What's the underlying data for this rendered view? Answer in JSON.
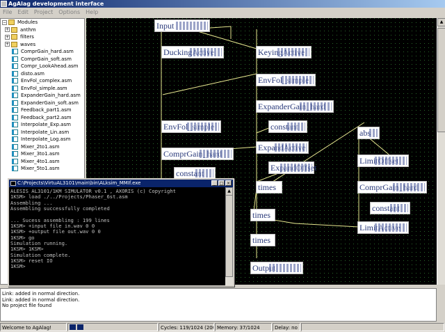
{
  "window": {
    "title": "AgAlag development interface"
  },
  "menu": [
    "File",
    "Edit",
    "Project",
    "Options",
    "Help"
  ],
  "tree": {
    "root": "Modules",
    "folders": [
      "anthm",
      "filters",
      "waves"
    ],
    "files": [
      "ComprGain_hard.asm",
      "ComprGain_soft.asm",
      "Compr_LookAhead.asm",
      "disto.asm",
      "EnvFol_complex.asm",
      "EnvFol_simple.asm",
      "ExpanderGain_hard.asm",
      "ExpanderGain_soft.asm",
      "Feedback_part1.asm",
      "Feedback_part2.asm",
      "Interpolate_Exp.asm",
      "Interpolate_Lin.asm",
      "Interpolate_Log.asm",
      "Mixer_2to1.asm",
      "Mixer_3to1.asm",
      "Mixer_4to1.asm",
      "Mixer_5to1.asm"
    ]
  },
  "nodes": {
    "input": "Input",
    "ducking_active": "DuckingActive",
    "keying_active": "KeyingActive",
    "envfol_simple_1": "EnvFol_simple",
    "expandergain_hard": "ExpanderGain_hard",
    "constant_1": "constant",
    "envfol_simple_2": "EnvFol_simple",
    "expand_active": "ExpandActive",
    "comprgain_hard_1": "ComprGain_hard",
    "constant_2": "constant",
    "expand_offset": "ExpandOffset",
    "times_1": "times",
    "times_2": "times",
    "times_3": "times",
    "output": "Output",
    "abs": "abs",
    "limit_offset": "LimitOffset",
    "comprgain_hard_2": "ComprGain_hard",
    "constant_3": "constant",
    "limit_active": "LimitActive"
  },
  "console": {
    "title": "C:\\Projects\\VirtuAL3101\\main\\bin\\ALksim_MMIf.exe",
    "lines": [
      "ALESIS AL3101/1KM SIMULATOR v0.1 , AXORIS (c) Copyright",
      "1KSM> load ./../Projects/Phaser_6st.asm",
      "Assembling ...",
      "Assembling successfully completed",
      "",
      "... Sucess assembling : 199 lines",
      "1KSM> +input file in.wav 0 0",
      "1KSM> +output file out.wav 0 0",
      "1KSM> go",
      "Simulation running.",
      "1KSM> 1KSM>",
      "Simulation complete.",
      "1KSM> reset IO",
      "1KSM>"
    ]
  },
  "log": [
    "Link: added in normal direction.",
    "Link: added in normal direction.",
    "No project file found"
  ],
  "status": {
    "welcome": "Welcome to AgAlag!",
    "cycles": "Cycles: 119/1024 (200)",
    "memory": "Memory: 37/1024",
    "delay": "Delay: no"
  },
  "colors": {
    "canvas_bg": "#000000",
    "grid_dot": "#2a6a2a",
    "wire": "#e8e890",
    "titlebar": "#0a246a"
  }
}
